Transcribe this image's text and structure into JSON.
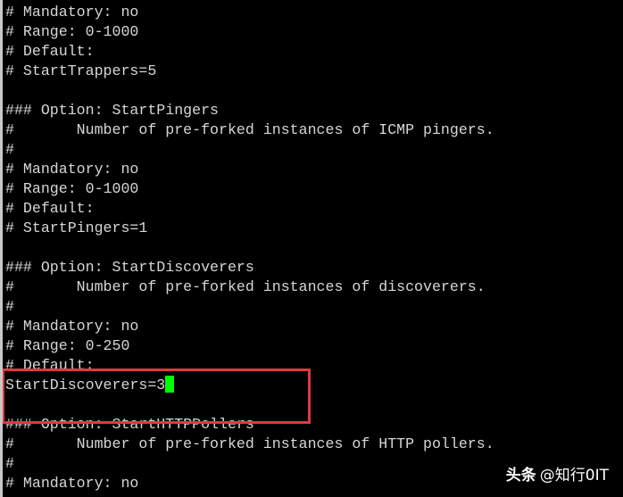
{
  "terminal": {
    "lines": [
      "# Mandatory: no",
      "# Range: 0-1000",
      "# Default:",
      "# StartTrappers=5",
      "",
      "### Option: StartPingers",
      "#       Number of pre-forked instances of ICMP pingers.",
      "#",
      "# Mandatory: no",
      "# Range: 0-1000",
      "# Default:",
      "# StartPingers=1",
      "",
      "### Option: StartDiscoverers",
      "#       Number of pre-forked instances of discoverers.",
      "#",
      "# Mandatory: no",
      "# Range: 0-250",
      "# Default:",
      "StartDiscoverers=3",
      "",
      "### Option: StartHTTPPollers",
      "#       Number of pre-forked instances of HTTP pollers.",
      "#",
      "# Mandatory: no"
    ],
    "cursor_line_index": 19,
    "cursor_color": "#00ff00",
    "highlight_color": "#e0383e"
  },
  "watermark": {
    "brand": "头条",
    "handle": "@知行0IT"
  }
}
